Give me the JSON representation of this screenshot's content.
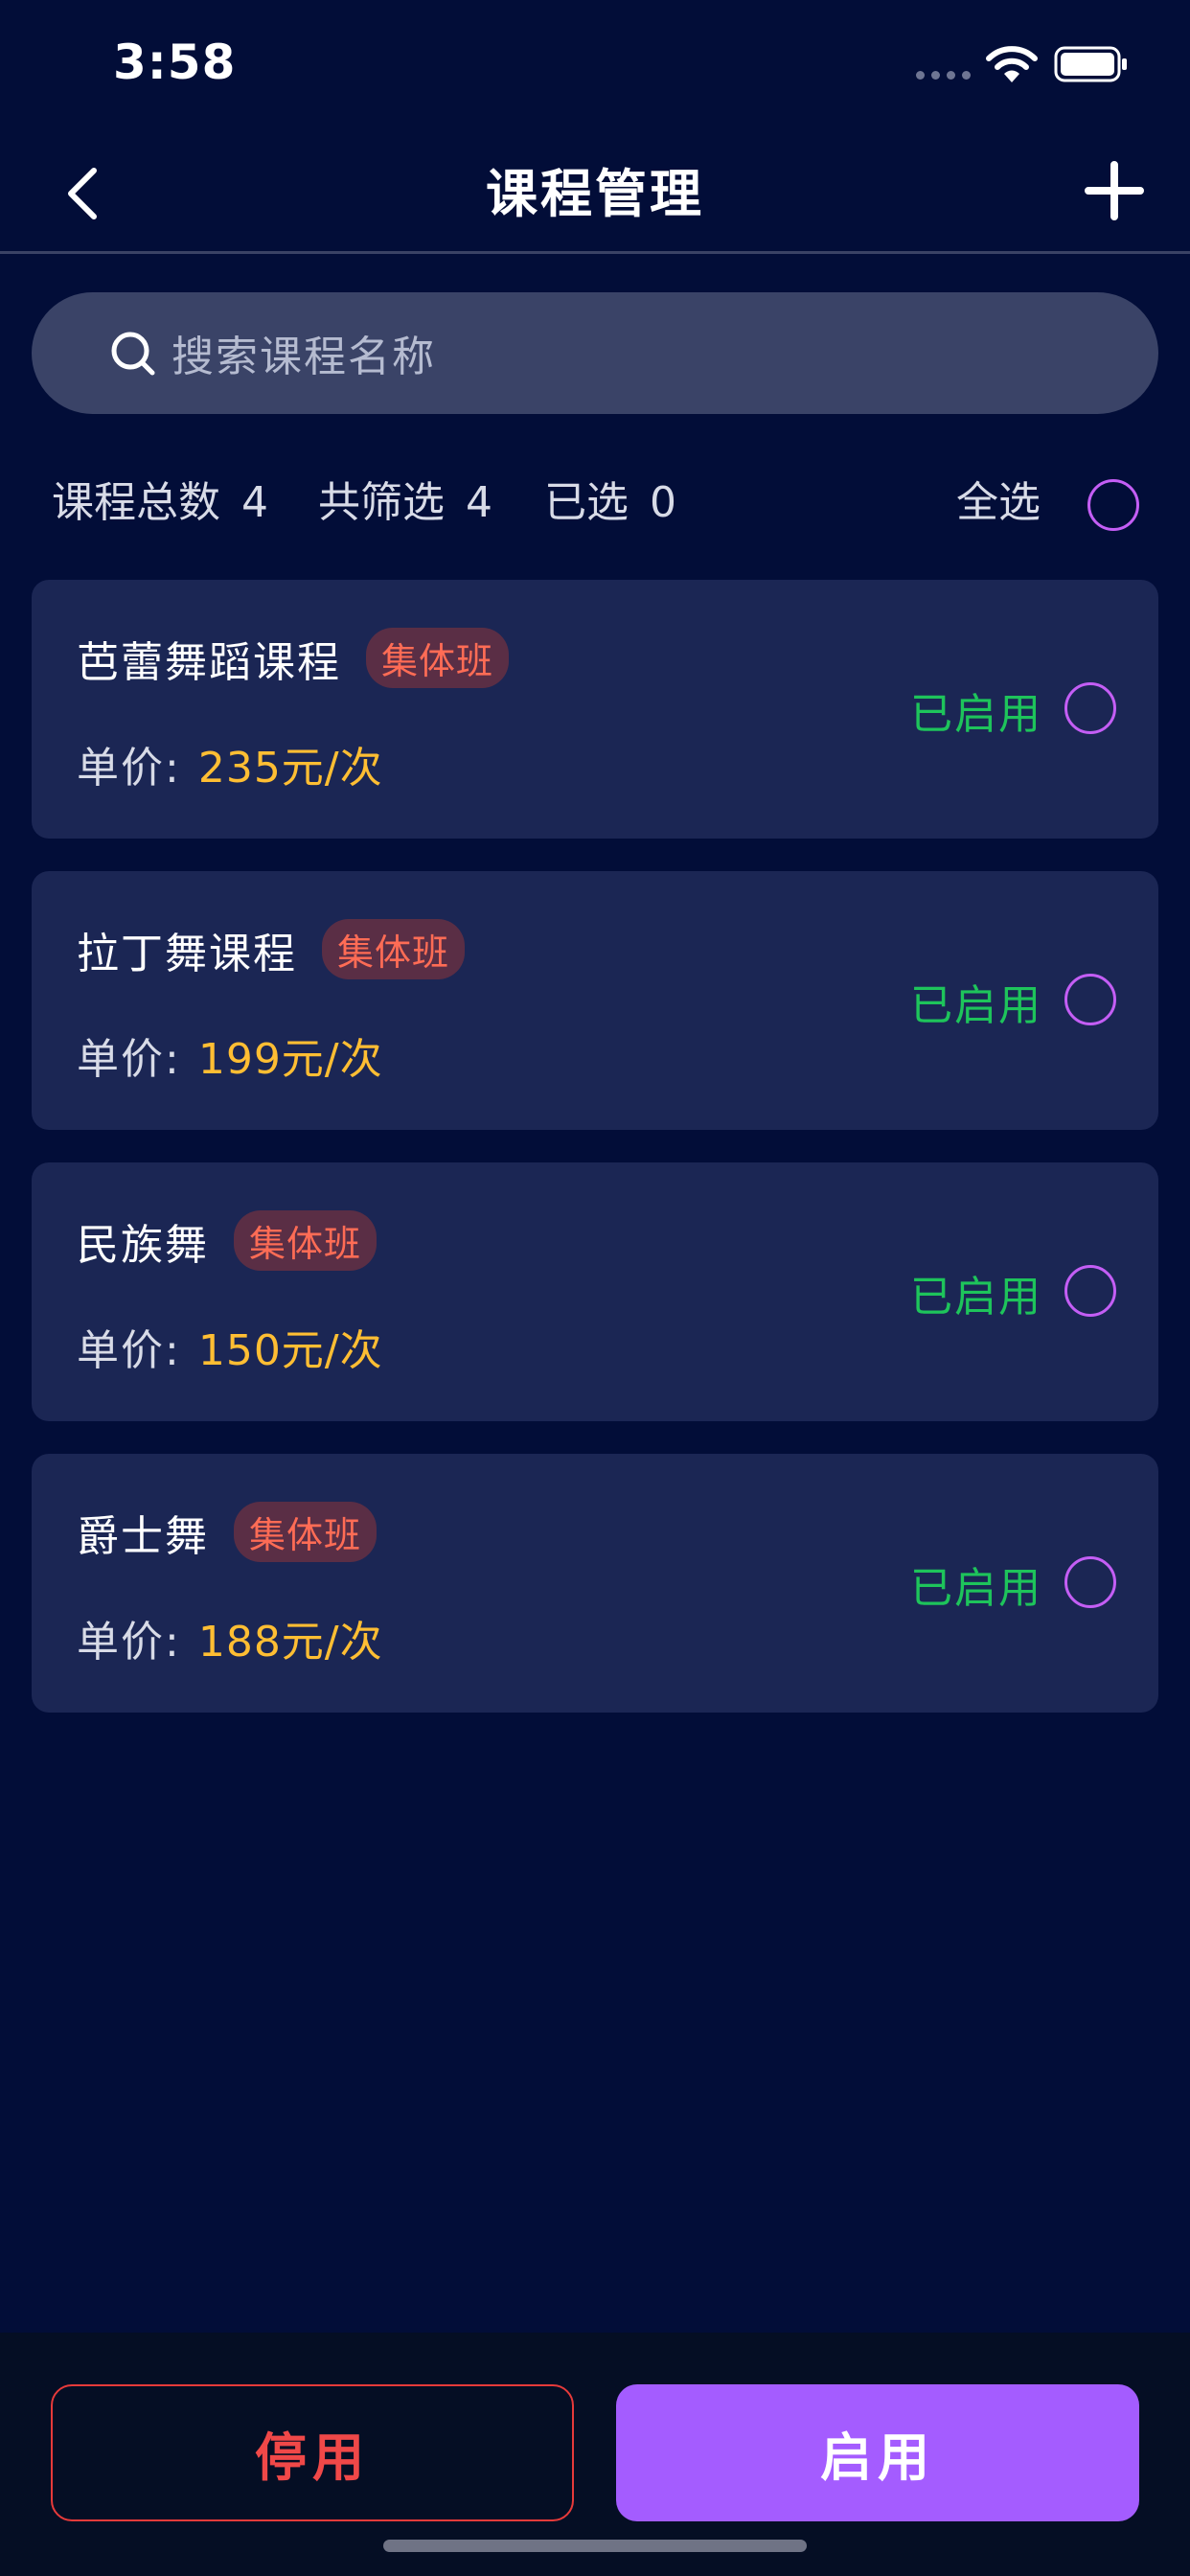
{
  "status_bar": {
    "time": "3:58"
  },
  "nav": {
    "title": "课程管理"
  },
  "search": {
    "placeholder": "搜索课程名称"
  },
  "summary": {
    "total_label": "课程总数",
    "total_value": "4",
    "filtered_label": "共筛选",
    "filtered_value": "4",
    "selected_label": "已选",
    "selected_value": "0",
    "select_all_label": "全选"
  },
  "courses": [
    {
      "name": "芭蕾舞蹈课程",
      "tag": "集体班",
      "price_label": "单价:",
      "price": "235元/次",
      "status": "已启用"
    },
    {
      "name": "拉丁舞课程",
      "tag": "集体班",
      "price_label": "单价:",
      "price": "199元/次",
      "status": "已启用"
    },
    {
      "name": "民族舞",
      "tag": "集体班",
      "price_label": "单价:",
      "price": "150元/次",
      "status": "已启用"
    },
    {
      "name": "爵士舞",
      "tag": "集体班",
      "price_label": "单价:",
      "price": "188元/次",
      "status": "已启用"
    }
  ],
  "actions": {
    "disable_label": "停用",
    "enable_label": "启用"
  },
  "colors": {
    "background": "#020d38",
    "card": "#1b2654",
    "accent_purple": "#a45cff",
    "status_green": "#1ec45b",
    "price_yellow": "#ffbe33",
    "tag_red": "#ff6c55",
    "danger": "#f04848"
  },
  "icons": {
    "back": "chevron-left-icon",
    "add": "plus-icon",
    "search": "search-icon",
    "wifi": "wifi-icon",
    "battery": "battery-icon"
  }
}
